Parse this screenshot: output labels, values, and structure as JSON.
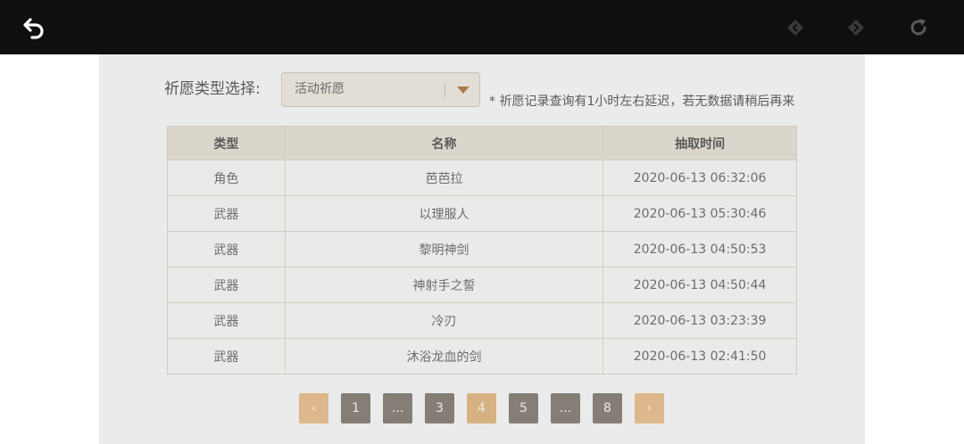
{
  "toolbar": {
    "back_icon": "back-arrow-icon",
    "prev_icon": "diamond-left-icon",
    "next_icon": "diamond-right-icon",
    "reload_icon": "reload-icon"
  },
  "filter": {
    "label": "祈愿类型选择:",
    "selected": "活动祈愿",
    "notice": "* 祈愿记录查询有1小时左右延迟，若无数据请稍后再来"
  },
  "table": {
    "headers": [
      "类型",
      "名称",
      "抽取时间"
    ],
    "rows": [
      [
        "角色",
        "芭芭拉",
        "2020-06-13 06:32:06"
      ],
      [
        "武器",
        "以理服人",
        "2020-06-13 05:30:46"
      ],
      [
        "武器",
        "黎明神剑",
        "2020-06-13 04:50:53"
      ],
      [
        "武器",
        "神射手之誓",
        "2020-06-13 04:50:44"
      ],
      [
        "武器",
        "冷刃",
        "2020-06-13 03:23:39"
      ],
      [
        "武器",
        "沐浴龙血的剑",
        "2020-06-13 02:41:50"
      ]
    ]
  },
  "pagination": {
    "prev": "‹",
    "pages": [
      "1",
      "...",
      "3",
      "4",
      "5",
      "...",
      "8"
    ],
    "next": "›",
    "current": "4"
  },
  "colors": {
    "accent": "#d6b283",
    "page_button": "#857e77",
    "topbar": "#0f0f0f"
  }
}
